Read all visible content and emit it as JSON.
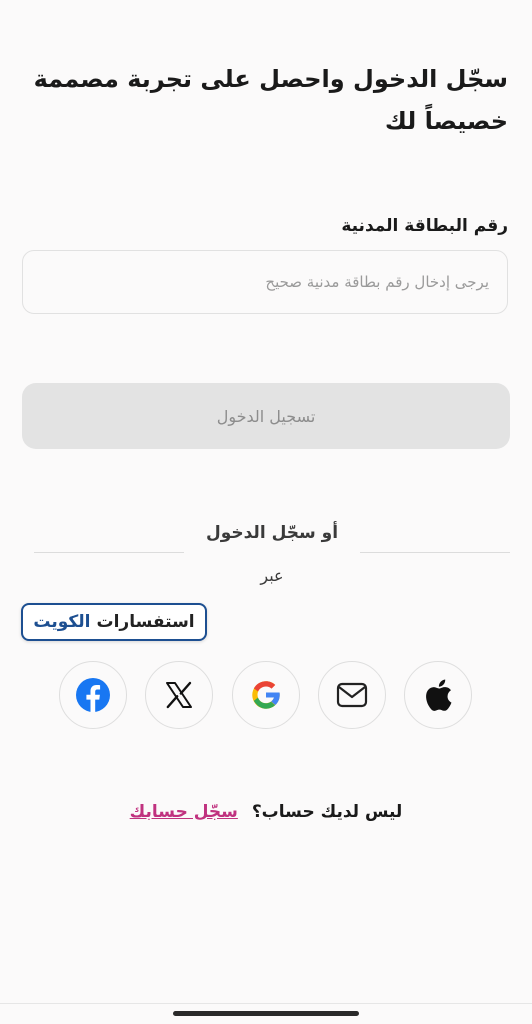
{
  "header": {
    "title": "سجّل الدخول واحصل على تجربة مصممة خصيصاً لك"
  },
  "form": {
    "civil_id_label": "رقم البطاقة المدنية",
    "civil_id_placeholder": "يرجى إدخال رقم بطاقة مدنية صحيح",
    "civil_id_value": "",
    "login_button": "تسجيل الدخول"
  },
  "divider": {
    "text": "أو سجّل الدخول",
    "via": "عبر"
  },
  "badge": {
    "word1": "استفسارات",
    "word2": "الكويت"
  },
  "social": {
    "icons": [
      "facebook-icon",
      "x-icon",
      "google-icon",
      "email-icon",
      "apple-icon"
    ],
    "colors": {
      "facebook": "#1877f2",
      "x": "#111111",
      "google_blue": "#4285f4",
      "google_red": "#ea4335",
      "google_yellow": "#fbbc05",
      "google_green": "#34a853"
    }
  },
  "footer": {
    "question": "ليس لديك حساب؟",
    "signup_link": "سجّل حسابك",
    "link_color": "#c0327f"
  }
}
